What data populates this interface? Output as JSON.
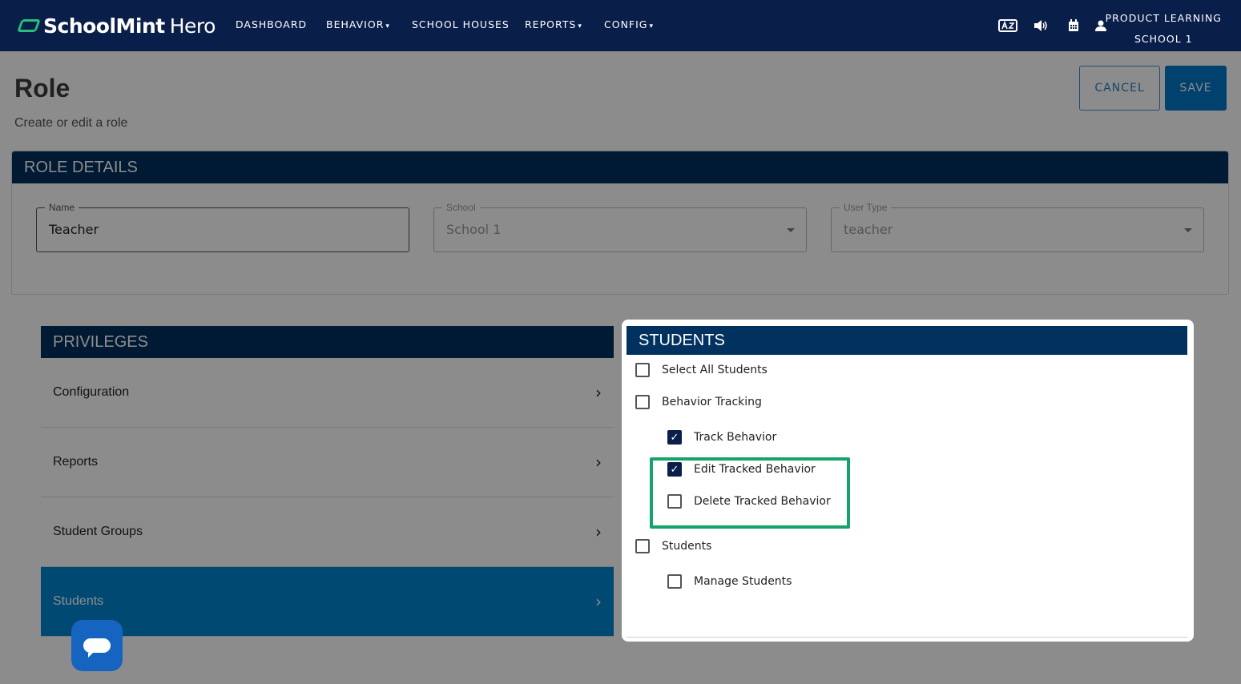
{
  "nav": {
    "logo_bold": "SchoolMint",
    "logo_light": "Hero",
    "items": [
      {
        "label": "DASHBOARD",
        "caret": ""
      },
      {
        "label": "BEHAVIOR",
        "caret": "▾"
      },
      {
        "label": "SCHOOL HOUSES",
        "caret": ""
      },
      {
        "label": "REPORTS",
        "caret": "▾"
      },
      {
        "label": "CONFIG",
        "caret": "▾"
      }
    ],
    "icons": [
      "translate-icon",
      "speaker-icon",
      "calendar-icon",
      "user-icon"
    ],
    "user_line1": "PRODUCT LEARNING",
    "user_line2": "SCHOOL 1"
  },
  "page": {
    "title": "Role",
    "subtitle": "Create or edit a role",
    "cancel_label": "CANCEL",
    "save_label": "SAVE"
  },
  "role_details": {
    "header": "ROLE DETAILS",
    "name_label": "Name",
    "name_value": "Teacher",
    "school_label": "School",
    "school_value": "School 1",
    "user_type_label": "User Type",
    "user_type_value": "teacher"
  },
  "privileges": {
    "header": "PRIVILEGES",
    "items": [
      "Configuration",
      "Reports",
      "Student Groups",
      "Students"
    ],
    "selected": "Students"
  },
  "students": {
    "header": "STUDENTS",
    "permissions": [
      {
        "label": "Select All Students",
        "checked": false
      },
      {
        "label": "Behavior Tracking",
        "checked": false
      },
      {
        "label": "Track Behavior",
        "checked": true
      },
      {
        "label": "Edit Tracked Behavior",
        "checked": true
      },
      {
        "label": "Delete Tracked Behavior",
        "checked": false
      },
      {
        "label": "Students",
        "checked": false
      },
      {
        "label": "Manage Students",
        "checked": false
      }
    ]
  },
  "colors": {
    "nav_bg": "#0a1e4a",
    "header_bg": "#00315f",
    "accent": "#0077c8",
    "highlight": "#14a36a"
  }
}
